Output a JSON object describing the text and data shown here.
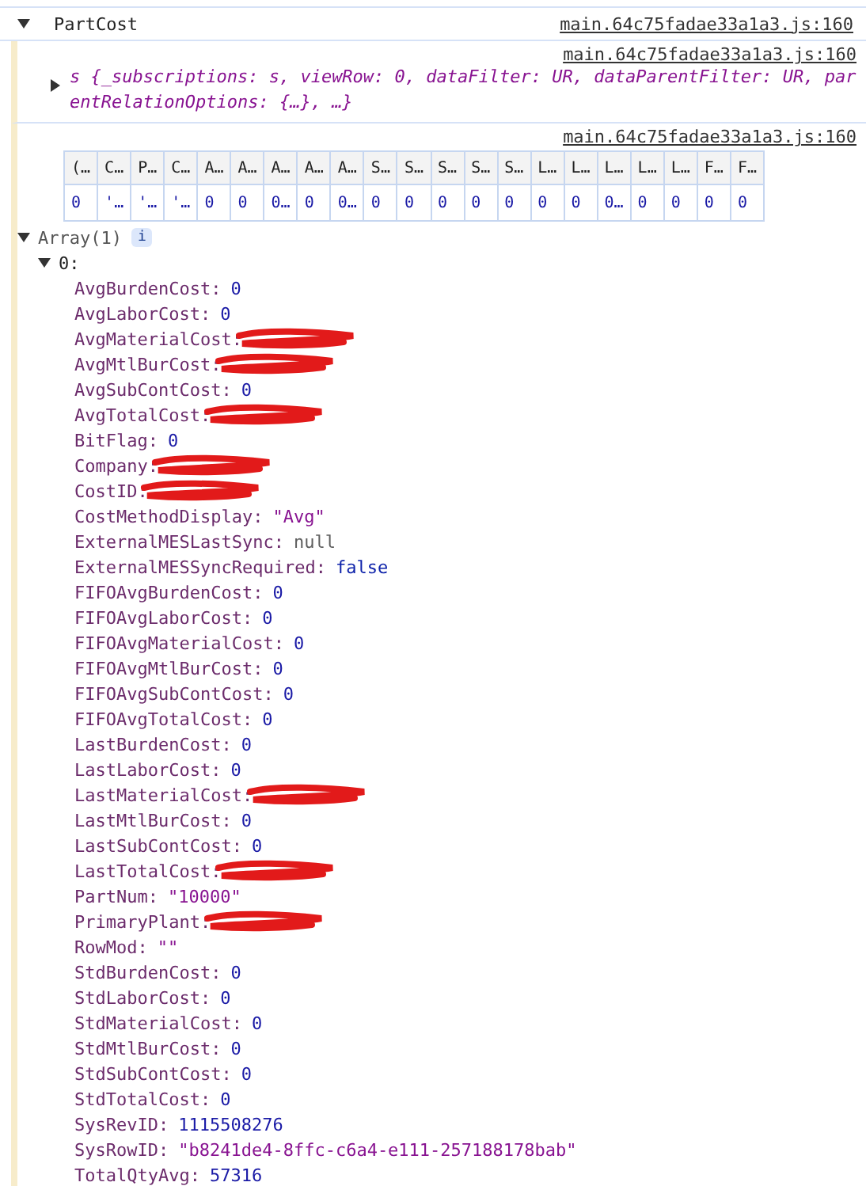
{
  "group": {
    "label": "PartCost",
    "expanded": true,
    "source": "main.64c75fadae33a1a3.js:160"
  },
  "object_message": {
    "source": "main.64c75fadae33a1a3.js:160",
    "expanded": false,
    "preview": "s {_subscriptions: s, viewRow: 0, dataFilter: UR, dataParentFilter: UR, parentRelationOptions: {…}, …}"
  },
  "table_message": {
    "source": "main.64c75fadae33a1a3.js:160",
    "columns": [
      "(…",
      "C…",
      "P…",
      "C…",
      "A…",
      "A…",
      "A…",
      "A…",
      "A…",
      "S…",
      "S…",
      "S…",
      "S…",
      "S…",
      "L…",
      "L…",
      "L…",
      "L…",
      "L…",
      "F…",
      "F…"
    ],
    "rows": [
      [
        "0",
        "'…",
        "'…",
        "'…",
        "0",
        "0",
        "0…",
        "0",
        "0…",
        "0",
        "0",
        "0",
        "0",
        "0",
        "0",
        "0",
        "0…",
        "0",
        "0",
        "0",
        "0"
      ]
    ]
  },
  "array": {
    "label": "Array(1)",
    "badge": "i",
    "expanded": true,
    "item": {
      "label": "0:",
      "expanded": true,
      "properties": [
        {
          "key": "AvgBurdenCost:",
          "value": "0",
          "kind": "number"
        },
        {
          "key": "AvgLaborCost:",
          "value": "0",
          "kind": "number"
        },
        {
          "key": "AvgMaterialCost:",
          "kind": "redacted"
        },
        {
          "key": "AvgMtlBurCost:",
          "kind": "redacted"
        },
        {
          "key": "AvgSubContCost:",
          "value": "0",
          "kind": "number"
        },
        {
          "key": "AvgTotalCost:",
          "kind": "redacted"
        },
        {
          "key": "BitFlag:",
          "value": "0",
          "kind": "number"
        },
        {
          "key": "Company:",
          "kind": "redacted"
        },
        {
          "key": "CostID:",
          "kind": "redacted"
        },
        {
          "key": "CostMethodDisplay:",
          "value": "\"Avg\"",
          "kind": "string"
        },
        {
          "key": "ExternalMESLastSync:",
          "value": "null",
          "kind": "null"
        },
        {
          "key": "ExternalMESSyncRequired:",
          "value": "false",
          "kind": "boolean"
        },
        {
          "key": "FIFOAvgBurdenCost:",
          "value": "0",
          "kind": "number"
        },
        {
          "key": "FIFOAvgLaborCost:",
          "value": "0",
          "kind": "number"
        },
        {
          "key": "FIFOAvgMaterialCost:",
          "value": "0",
          "kind": "number"
        },
        {
          "key": "FIFOAvgMtlBurCost:",
          "value": "0",
          "kind": "number"
        },
        {
          "key": "FIFOAvgSubContCost:",
          "value": "0",
          "kind": "number"
        },
        {
          "key": "FIFOAvgTotalCost:",
          "value": "0",
          "kind": "number"
        },
        {
          "key": "LastBurdenCost:",
          "value": "0",
          "kind": "number"
        },
        {
          "key": "LastLaborCost:",
          "value": "0",
          "kind": "number"
        },
        {
          "key": "LastMaterialCost:",
          "kind": "redacted"
        },
        {
          "key": "LastMtlBurCost:",
          "value": "0",
          "kind": "number"
        },
        {
          "key": "LastSubContCost:",
          "value": "0",
          "kind": "number"
        },
        {
          "key": "LastTotalCost:",
          "kind": "redacted"
        },
        {
          "key": "PartNum:",
          "value": "\"10000\"",
          "kind": "string"
        },
        {
          "key": "PrimaryPlant:",
          "kind": "redacted"
        },
        {
          "key": "RowMod:",
          "value": "\"\"",
          "kind": "string"
        },
        {
          "key": "StdBurdenCost:",
          "value": "0",
          "kind": "number"
        },
        {
          "key": "StdLaborCost:",
          "value": "0",
          "kind": "number"
        },
        {
          "key": "StdMaterialCost:",
          "value": "0",
          "kind": "number"
        },
        {
          "key": "StdMtlBurCost:",
          "value": "0",
          "kind": "number"
        },
        {
          "key": "StdSubContCost:",
          "value": "0",
          "kind": "number"
        },
        {
          "key": "StdTotalCost:",
          "value": "0",
          "kind": "number"
        },
        {
          "key": "SysRevID:",
          "value": "1115508276",
          "kind": "number"
        },
        {
          "key": "SysRowID:",
          "value": "\"b8241de4-8ffc-c6a4-e111-257188178bab\"",
          "kind": "string"
        },
        {
          "key": "TotalQtyAvg:",
          "value": "57316",
          "kind": "number"
        }
      ]
    }
  }
}
